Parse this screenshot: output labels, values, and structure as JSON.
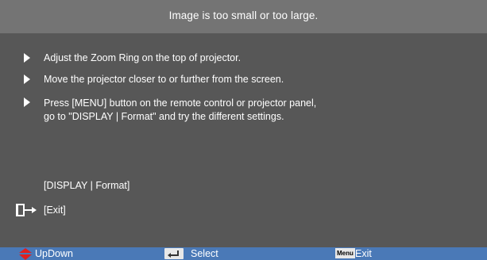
{
  "title": "Image is too small or too large.",
  "steps": [
    {
      "line1": "Adjust the Zoom Ring on the top of projector.",
      "line2": ""
    },
    {
      "line1": "Move the projector closer to or further from the screen.",
      "line2": ""
    },
    {
      "line1": "Press [MENU] button on the remote control or projector panel,",
      "line2": "go to \"DISPLAY | Format\" and try the different settings."
    }
  ],
  "link_label": "[DISPLAY | Format]",
  "exit_label": "[Exit]",
  "footer": {
    "updown_label": "UpDown",
    "select_label": "Select",
    "menu_key_label": "Menu",
    "exit_label": "Exit"
  },
  "colors": {
    "title_bar": "#747474",
    "body": "#575757",
    "footer": "#4a79b7",
    "updown_icon": "#e02020"
  },
  "icons": {
    "bullet": "triangle-right-icon",
    "exit": "exit-door-icon",
    "updown": "up-down-arrow-icon",
    "select": "enter-key-icon",
    "menu": "menu-key-icon"
  }
}
